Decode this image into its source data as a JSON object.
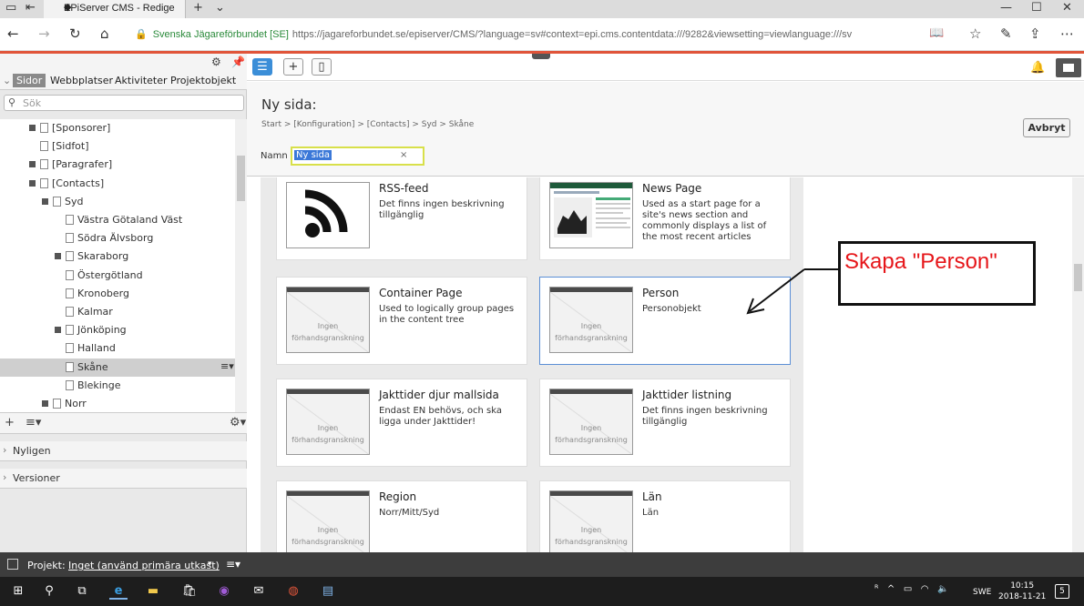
{
  "browser": {
    "tab_title": "EPiServer CMS - Redige",
    "address_org": "Svenska Jägareförbundet [SE]",
    "address_url": "https://jagareforbundet.se/episerver/CMS/?language=sv#context=epi.cms.contentdata:///9282&viewsetting=viewlanguage:///sv"
  },
  "left_panel": {
    "tabs": [
      "Sidor",
      "Webbplatser",
      "Aktiviteter",
      "Projektobjekt"
    ],
    "search_placeholder": "Sök",
    "tree": [
      {
        "label": "[Sponsorer]",
        "indent": 2,
        "expandable": true
      },
      {
        "label": "[Sidfot]",
        "indent": 2,
        "expandable": false
      },
      {
        "label": "[Paragrafer]",
        "indent": 2,
        "expandable": true
      },
      {
        "label": "[Contacts]",
        "indent": 2,
        "expandable": true
      },
      {
        "label": "Syd",
        "indent": 3,
        "expandable": true
      },
      {
        "label": "Västra Götaland Väst",
        "indent": 4,
        "expandable": false
      },
      {
        "label": "Södra Älvsborg",
        "indent": 4,
        "expandable": false
      },
      {
        "label": "Skaraborg",
        "indent": 4,
        "expandable": true
      },
      {
        "label": "Östergötland",
        "indent": 4,
        "expandable": false
      },
      {
        "label": "Kronoberg",
        "indent": 4,
        "expandable": false
      },
      {
        "label": "Kalmar",
        "indent": 4,
        "expandable": false
      },
      {
        "label": "Jönköping",
        "indent": 4,
        "expandable": true
      },
      {
        "label": "Halland",
        "indent": 4,
        "expandable": false
      },
      {
        "label": "Skåne",
        "indent": 4,
        "expandable": false,
        "selected": true
      },
      {
        "label": "Blekinge",
        "indent": 4,
        "expandable": false
      },
      {
        "label": "Norr",
        "indent": 3,
        "expandable": true
      }
    ],
    "accordions": [
      "Nyligen",
      "Versioner"
    ]
  },
  "form": {
    "title": "Ny sida:",
    "breadcrumb": "Start > [Konfiguration] > [Contacts] > Syd > Skåne",
    "cancel_label": "Avbryt",
    "name_label": "Namn",
    "name_value": "Ny sida"
  },
  "page_types": [
    {
      "name": "RSS-feed",
      "desc": "Det finns ingen beskrivning tillgänglig",
      "thumb": "rss"
    },
    {
      "name": "News Page",
      "desc": "Used as a start page for a site's news section and commonly displays a list of the most recent articles",
      "thumb": "news"
    },
    {
      "name": "Container Page",
      "desc": "Used to logically group pages in the content tree",
      "thumb": "none"
    },
    {
      "name": "Person",
      "desc": "Personobjekt",
      "thumb": "none",
      "selected": true
    },
    {
      "name": "Jakttider djur mallsida",
      "desc": "Endast EN behövs, och ska ligga under Jakttider!",
      "thumb": "none"
    },
    {
      "name": "Jakttider listning",
      "desc": "Det finns ingen beskrivning tillgänglig",
      "thumb": "none"
    },
    {
      "name": "Region",
      "desc": "Norr/Mitt/Syd",
      "thumb": "none"
    },
    {
      "name": "Län",
      "desc": "Län",
      "thumb": "none"
    }
  ],
  "no_preview": "Ingen förhandsgranskning",
  "annotation": "Skapa \"Person\"",
  "project_bar": {
    "label": "Projekt:",
    "value": "Inget (använd primära utkast)"
  },
  "taskbar": {
    "lang": "SWE",
    "time": "10:15",
    "date": "2018-11-21",
    "notifications": "5"
  },
  "colors": {
    "accent_red": "#e0553a",
    "selected_border": "#5b8fd6",
    "annotation_red": "#e6161a"
  }
}
